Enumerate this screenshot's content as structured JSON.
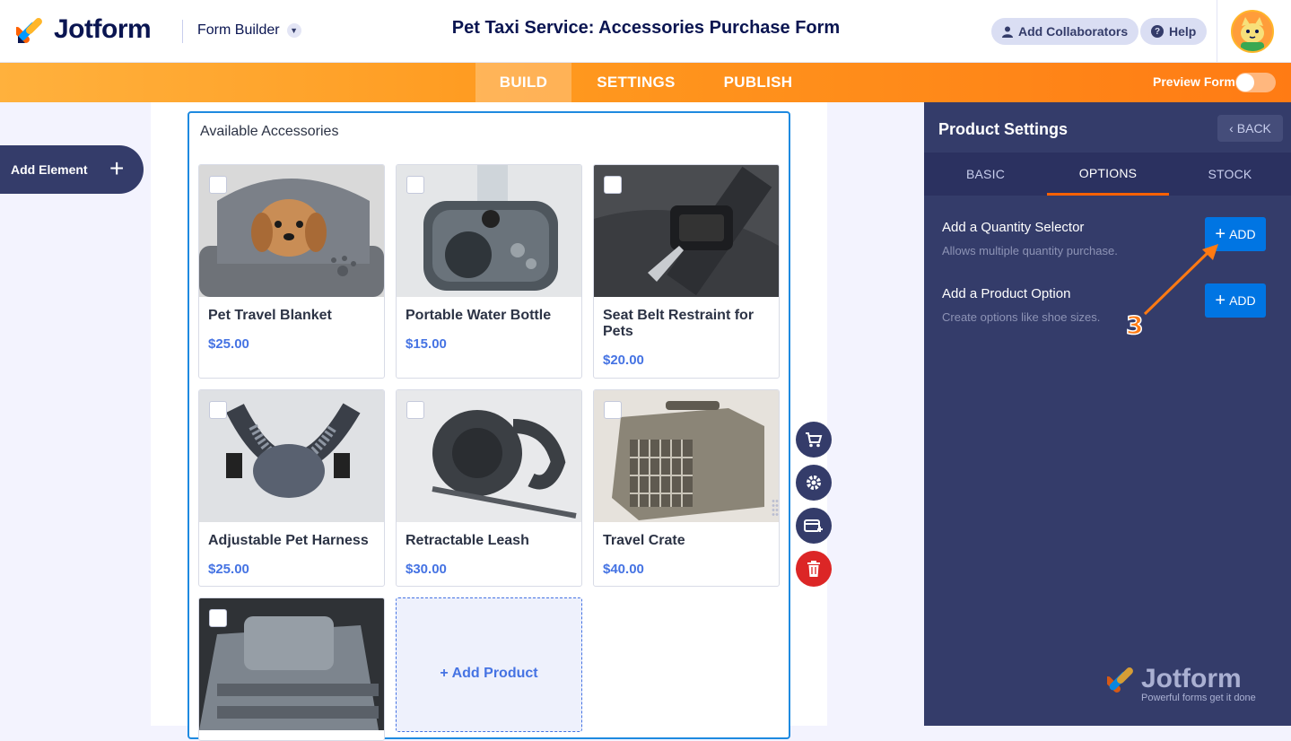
{
  "app": {
    "logo_text": "Jotform",
    "builder_label": "Form Builder",
    "form_title": "Pet Taxi Service: Accessories Purchase Form",
    "collaborators_label": "Add Collaborators",
    "help_label": "Help"
  },
  "nav": {
    "tabs": [
      {
        "label": "BUILD",
        "active": true
      },
      {
        "label": "SETTINGS",
        "active": false
      },
      {
        "label": "PUBLISH",
        "active": false
      }
    ],
    "preview_label": "Preview Form",
    "preview_on": false
  },
  "left": {
    "add_element_label": "Add Element"
  },
  "form": {
    "field_label": "Available Accessories",
    "products": [
      {
        "name": "Pet Travel Blanket",
        "price": "$25.00"
      },
      {
        "name": "Portable Water Bottle",
        "price": "$15.00"
      },
      {
        "name": "Seat Belt Restraint for Pets",
        "price": "$20.00"
      },
      {
        "name": "Adjustable Pet Harness",
        "price": "$25.00"
      },
      {
        "name": "Retractable Leash",
        "price": "$30.00"
      },
      {
        "name": "Travel Crate",
        "price": "$40.00"
      },
      {
        "name": "",
        "price": ""
      }
    ],
    "add_product_label": "+ Add Product"
  },
  "panel": {
    "title": "Product Settings",
    "back_label": "BACK",
    "tabs": [
      {
        "label": "BASIC",
        "active": false
      },
      {
        "label": "OPTIONS",
        "active": true
      },
      {
        "label": "STOCK",
        "active": false
      }
    ],
    "options": [
      {
        "title": "Add a Quantity Selector",
        "desc": "Allows multiple quantity purchase.",
        "button": "ADD"
      },
      {
        "title": "Add a Product Option",
        "desc": "Create options like shoe sizes.",
        "button": "ADD"
      }
    ],
    "step_marker": "3",
    "watermark_title": "Jotform",
    "watermark_sub": "Powerful forms get it done"
  },
  "colors": {
    "accent_orange": "#ff7a12",
    "panel_bg": "#343c6a",
    "add_blue": "#0075e3",
    "price_blue": "#4573e3",
    "selected_border": "#1e8ae0"
  }
}
